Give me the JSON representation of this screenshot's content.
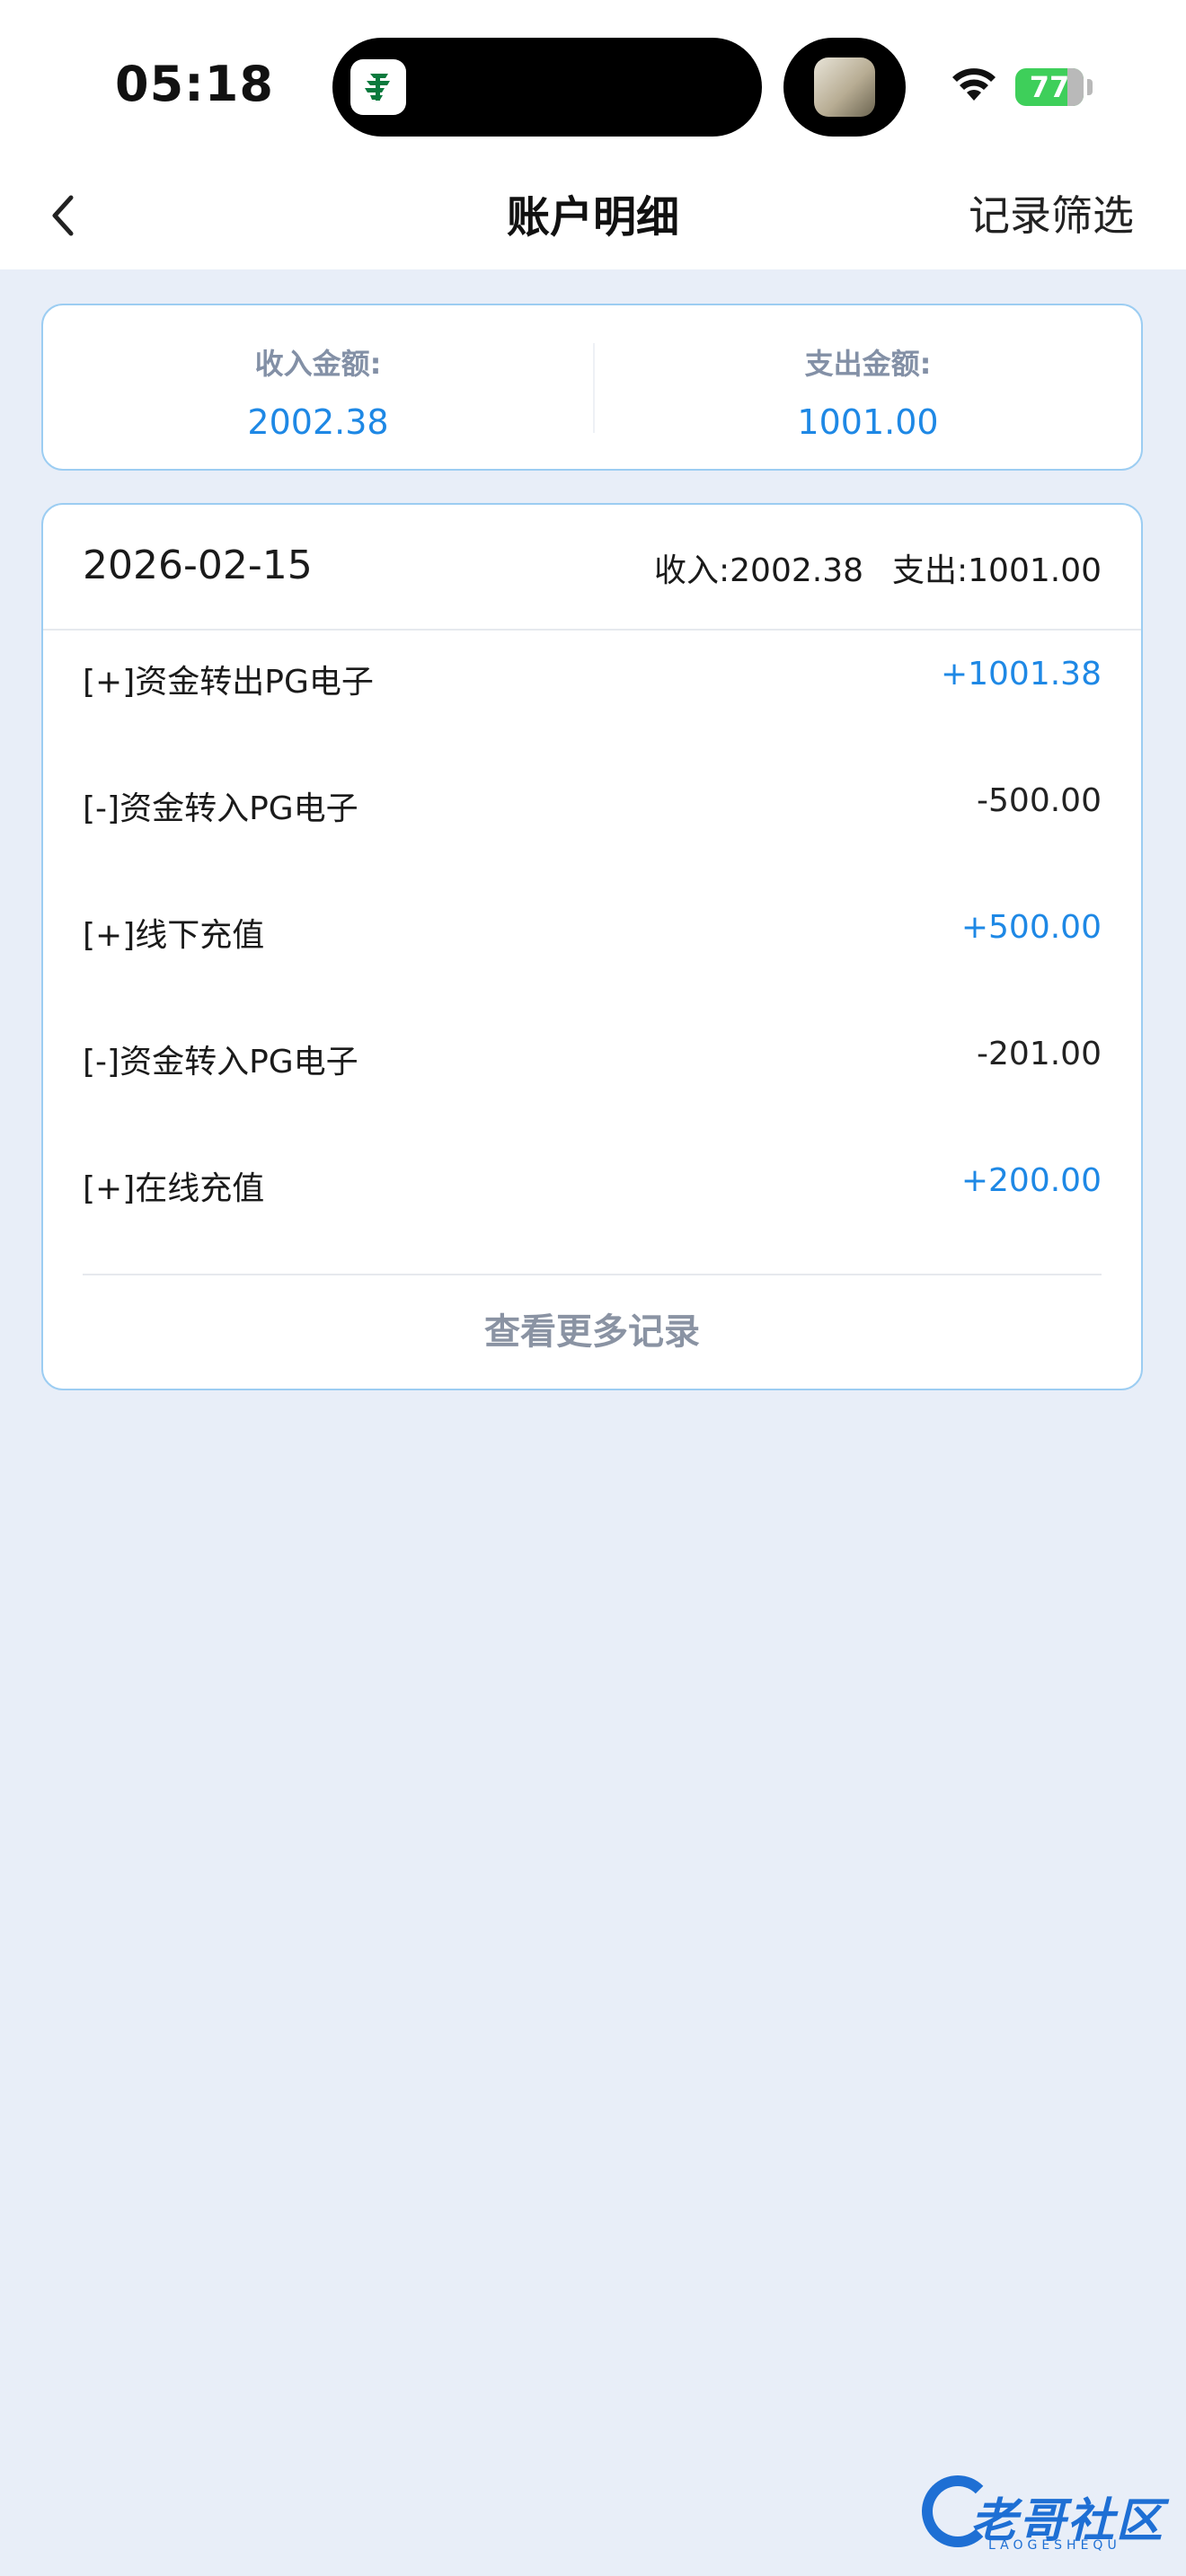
{
  "status_bar": {
    "time": "05:18",
    "battery": "77"
  },
  "nav": {
    "title": "账户明细",
    "filter_label": "记录筛选"
  },
  "summary": {
    "income_label": "收入金额:",
    "income_value": "2002.38",
    "expense_label": "支出金额:",
    "expense_value": "1001.00"
  },
  "records": {
    "date": "2026-02-15",
    "income_summary": "收入:2002.38",
    "expense_summary": "支出:1001.00",
    "items": [
      {
        "name": "[+]资金转出PG电子",
        "amount": "+1001.38",
        "type": "income"
      },
      {
        "name": "[-]资金转入PG电子",
        "amount": "-500.00",
        "type": "expense"
      },
      {
        "name": "[+]线下充值",
        "amount": "+500.00",
        "type": "income"
      },
      {
        "name": "[-]资金转入PG电子",
        "amount": "-201.00",
        "type": "expense"
      },
      {
        "name": "[+]在线充值",
        "amount": "+200.00",
        "type": "income"
      }
    ],
    "more_label": "查看更多记录"
  },
  "watermark": {
    "text": "老哥社区",
    "sub": "LAOGESHEQU"
  },
  "colors": {
    "accent": "#1e88e5",
    "background": "#e8eef8",
    "card_border": "#9ccdf2"
  }
}
